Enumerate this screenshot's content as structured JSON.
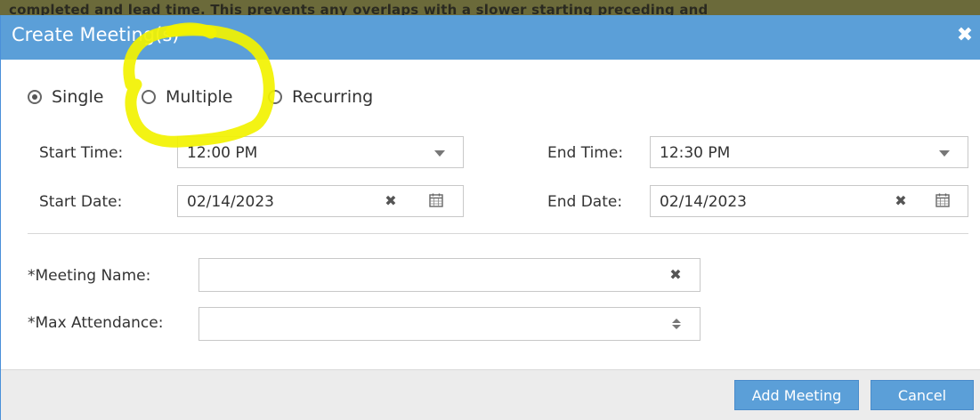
{
  "background": {
    "text": "completed and lead time. This prevents any overlaps with a slower starting preceding and"
  },
  "dialog": {
    "title": "Create Meeting(s)",
    "close_icon": "close-icon"
  },
  "mode": {
    "options": [
      {
        "label": "Single",
        "checked": true
      },
      {
        "label": "Multiple",
        "checked": false
      },
      {
        "label": "Recurring",
        "checked": false
      }
    ]
  },
  "schedule": {
    "start_time_label": "Start Time:",
    "start_time_value": "12:00 PM",
    "end_time_label": "End Time:",
    "end_time_value": "12:30 PM",
    "start_date_label": "Start Date:",
    "start_date_value": "02/14/2023",
    "end_date_label": "End Date:",
    "end_date_value": "02/14/2023"
  },
  "details": {
    "required_marker": "*",
    "meeting_name_label": "Meeting Name:",
    "meeting_name_value": "",
    "max_attendance_label": "Max Attendance:",
    "max_attendance_value": ""
  },
  "footer": {
    "add_label": "Add Meeting",
    "cancel_label": "Cancel"
  },
  "colors": {
    "titlebar": "#5b9fd8",
    "button": "#5b9fd8",
    "highlight_annotation": "#f2f200"
  }
}
